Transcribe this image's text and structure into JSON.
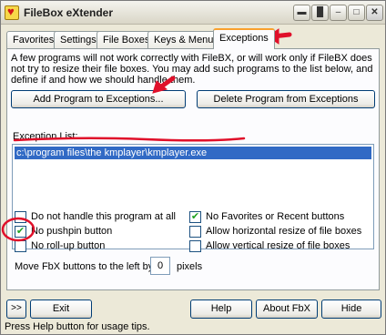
{
  "window": {
    "title": "FileBox eXtender",
    "controls": [
      "▬",
      "█",
      "–",
      "□",
      "✕"
    ]
  },
  "tabs": [
    {
      "label": "Favorites"
    },
    {
      "label": "Settings"
    },
    {
      "label": "File Boxes"
    },
    {
      "label": "Keys & Menus"
    },
    {
      "label": "Exceptions"
    }
  ],
  "exceptions": {
    "intro": "A few programs will not work correctly with FileBX, or will work only if FileBX does not try to resize their file boxes. You may add such programs to the list below, and define if and how we should handle them.",
    "add_label": "Add Program to Exceptions...",
    "delete_label": "Delete Program from Exceptions",
    "list_label": "Exception List:",
    "list_items": [
      "c:\\program files\\the kmplayer\\kmplayer.exe"
    ],
    "options_left": [
      {
        "label": "Do not handle this program at all",
        "checked": false
      },
      {
        "label": "No pushpin button",
        "checked": true
      },
      {
        "label": "No roll-up button",
        "checked": false
      }
    ],
    "options_right": [
      {
        "label": "No Favorites or Recent buttons",
        "checked": true
      },
      {
        "label": "Allow horizontal resize of file boxes",
        "checked": false
      },
      {
        "label": "Allow vertical resize of file boxes",
        "checked": false
      }
    ],
    "move_label": "Move FbX buttons to the left by",
    "move_value": "0",
    "move_unit": "pixels"
  },
  "footer": {
    "expand_label": ">>",
    "exit_label": "Exit",
    "help_label": "Help",
    "about_label": "About FbX",
    "hide_label": "Hide",
    "status": "Press Help button for usage tips."
  },
  "colors": {
    "annotation": "#e0102a",
    "selection": "#316ac5"
  }
}
